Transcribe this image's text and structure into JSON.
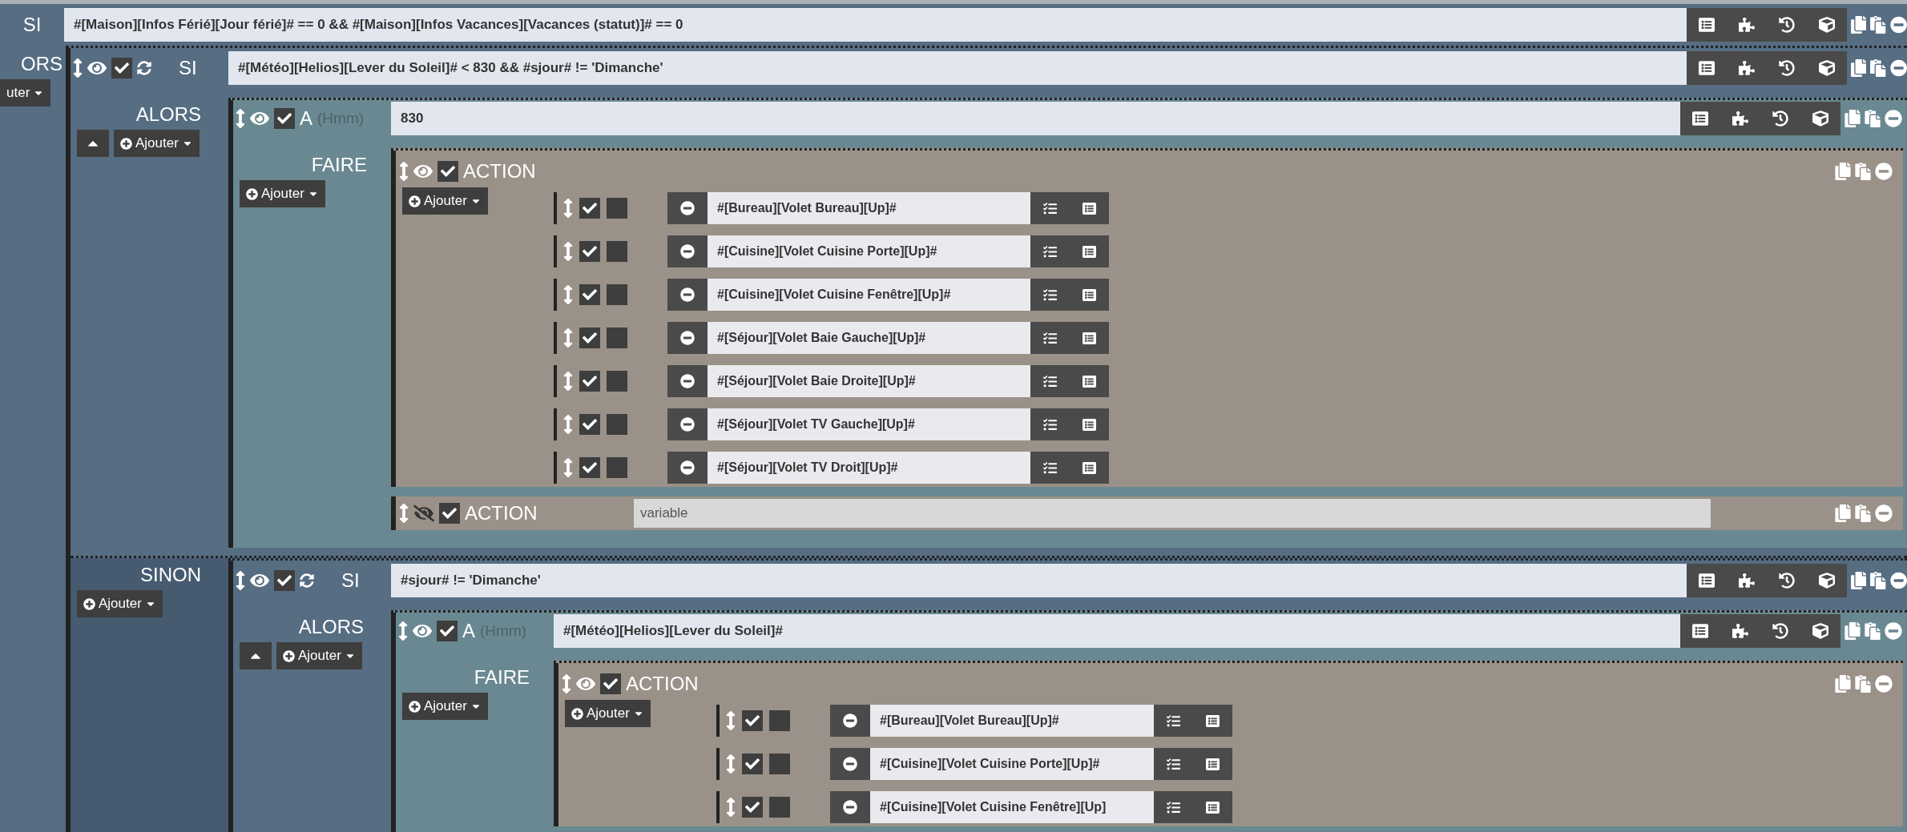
{
  "root": {
    "label": "SI",
    "expression": "#[Maison][Infos Férié][Jour férié]# == 0 && #[Maison][Infos Vacances][Vacances (statut)]# == 0",
    "then": {
      "label": "ORS",
      "add": "uter",
      "children": [
        {
          "kind": "si",
          "visible": true,
          "enabled": true,
          "label": "SI",
          "expression": "#[Météo][Helios][Lever du Soleil]# < 830 && #sjour# != 'Dimanche'",
          "then": {
            "label": "ALORS",
            "add": "Ajouter",
            "children": [
              {
                "kind": "a",
                "visible": true,
                "enabled": true,
                "label": "A",
                "hint": "(Hmm)",
                "expression": "830",
                "do": {
                  "label": "FAIRE",
                  "add": "Ajouter",
                  "children": [
                    {
                      "kind": "action",
                      "collapsed": false,
                      "visible": true,
                      "enabled": true,
                      "label": "ACTION",
                      "add": "Ajouter",
                      "actions": [
                        {
                          "enabled": true,
                          "option": false,
                          "command": "#[Bureau][Volet Bureau][Up]#"
                        },
                        {
                          "enabled": true,
                          "option": false,
                          "command": "#[Cuisine][Volet Cuisine Porte][Up]#"
                        },
                        {
                          "enabled": true,
                          "option": false,
                          "command": "#[Cuisine][Volet Cuisine Fenêtre][Up]#"
                        },
                        {
                          "enabled": true,
                          "option": false,
                          "command": "#[Séjour][Volet Baie Gauche][Up]#"
                        },
                        {
                          "enabled": true,
                          "option": false,
                          "command": "#[Séjour][Volet Baie Droite][Up]#"
                        },
                        {
                          "enabled": true,
                          "option": false,
                          "command": "#[Séjour][Volet TV Gauche][Up]#"
                        },
                        {
                          "enabled": true,
                          "option": false,
                          "command": "#[Séjour][Volet TV Droit][Up]#"
                        }
                      ]
                    },
                    {
                      "kind": "action",
                      "collapsed": true,
                      "visible": false,
                      "enabled": true,
                      "label": "ACTION",
                      "placeholder": "variable"
                    }
                  ]
                }
              }
            ]
          },
          "else": {
            "label": "SINON",
            "add": "Ajouter",
            "children": [
              {
                "kind": "si",
                "visible": true,
                "enabled": true,
                "label": "SI",
                "expression": "#sjour# != 'Dimanche'",
                "then": {
                  "label": "ALORS",
                  "add": "Ajouter",
                  "children": [
                    {
                      "kind": "a",
                      "visible": true,
                      "enabled": true,
                      "label": "A",
                      "hint": "(Hmm)",
                      "expression": "#[Météo][Helios][Lever du Soleil]#",
                      "do": {
                        "label": "FAIRE",
                        "add": "Ajouter",
                        "children": [
                          {
                            "kind": "action",
                            "collapsed": false,
                            "visible": true,
                            "enabled": true,
                            "label": "ACTION",
                            "add": "Ajouter",
                            "actions": [
                              {
                                "enabled": true,
                                "option": false,
                                "command": "#[Bureau][Volet Bureau][Up]#"
                              },
                              {
                                "enabled": true,
                                "option": false,
                                "command": "#[Cuisine][Volet Cuisine Porte][Up]#"
                              },
                              {
                                "enabled": true,
                                "option": false,
                                "command": "#[Cuisine][Volet Cuisine Fenêtre][Up]"
                              }
                            ]
                          }
                        ]
                      }
                    }
                  ]
                }
              }
            ]
          }
        }
      ]
    }
  }
}
